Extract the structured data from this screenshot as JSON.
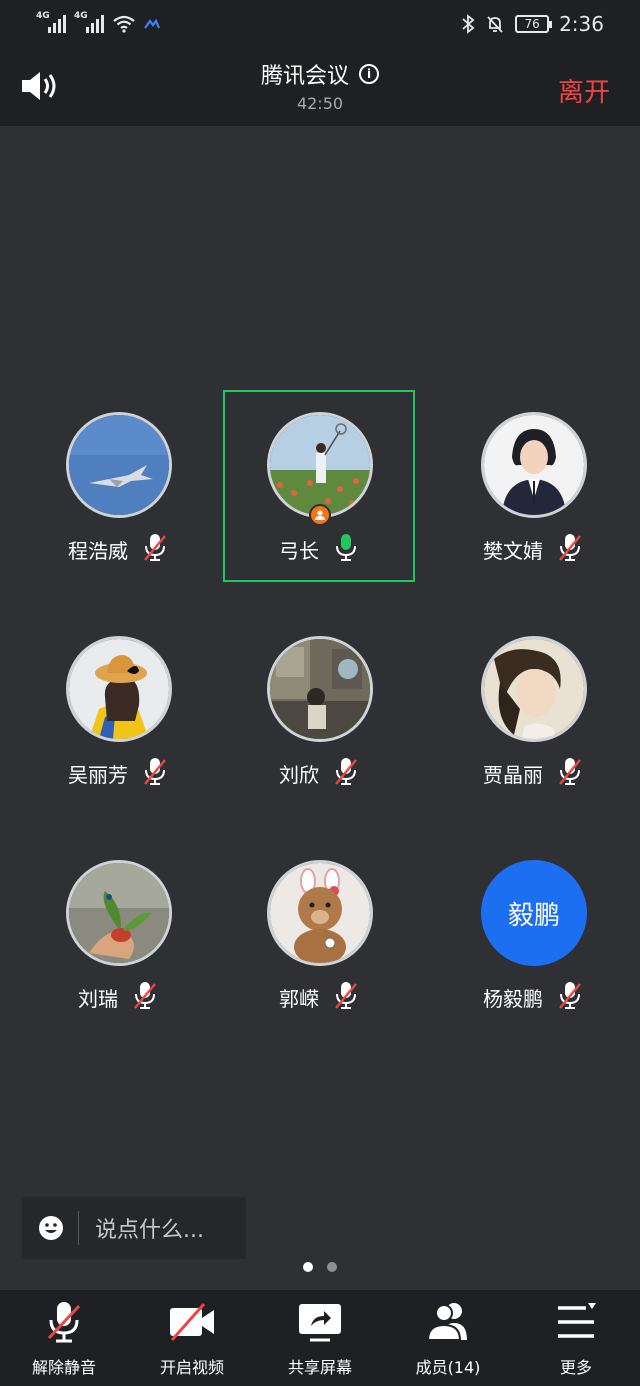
{
  "status_bar": {
    "network_1": "4G",
    "network_2": "4G",
    "battery": "76",
    "time": "2:36"
  },
  "header": {
    "title": "腾讯会议",
    "timer": "42:50",
    "leave_label": "离开"
  },
  "participants": [
    {
      "name": "程浩威",
      "mic": "muted",
      "avatar": "photo-jet"
    },
    {
      "name": "弓长",
      "mic": "active",
      "avatar": "photo-field",
      "host": true,
      "highlighted": true
    },
    {
      "name": "樊文婧",
      "mic": "muted",
      "avatar": "photo-woman-suit"
    },
    {
      "name": "吴丽芳",
      "mic": "muted",
      "avatar": "photo-hat-girl"
    },
    {
      "name": "刘欣",
      "mic": "muted",
      "avatar": "photo-room"
    },
    {
      "name": "贾晶丽",
      "mic": "muted",
      "avatar": "photo-painting"
    },
    {
      "name": "刘瑞",
      "mic": "muted",
      "avatar": "photo-plant"
    },
    {
      "name": "郭嵘",
      "mic": "muted",
      "avatar": "photo-teddy"
    },
    {
      "name": "杨毅鹏",
      "mic": "muted",
      "avatar_text": "毅鹏",
      "avatar_color": "#1d6ff2"
    }
  ],
  "chat": {
    "placeholder": "说点什么..."
  },
  "pagination": {
    "current": 1,
    "total": 2
  },
  "toolbar": {
    "unmute_label": "解除静音",
    "video_label": "开启视频",
    "share_label": "共享屏幕",
    "members_label": "成员(14)",
    "more_label": "更多"
  },
  "colors": {
    "background": "#2e3034",
    "bar": "#1f2023",
    "leave": "#ef4444",
    "active_border": "#22c55e",
    "host_badge": "#f97316",
    "text_avatar": "#1d6ff2"
  }
}
